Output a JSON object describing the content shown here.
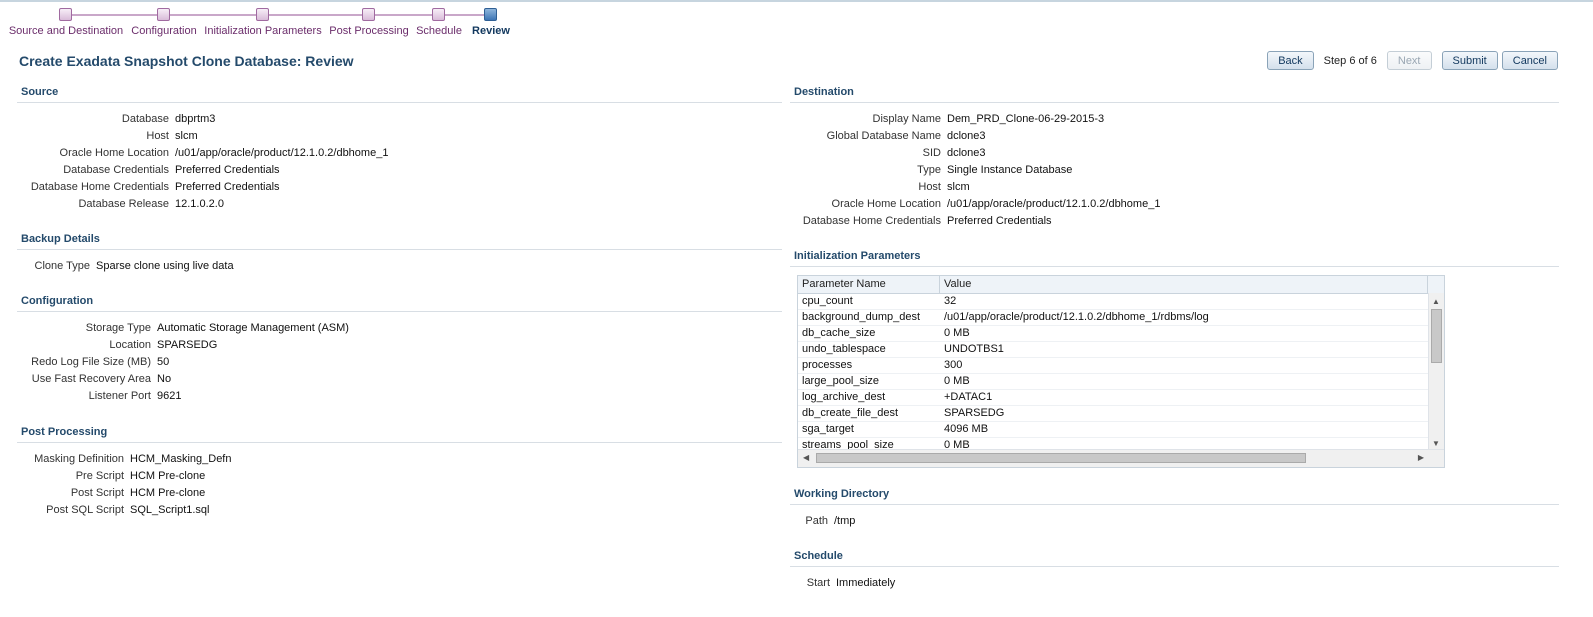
{
  "train": {
    "steps": [
      {
        "label": "Source and Destination"
      },
      {
        "label": "Configuration"
      },
      {
        "label": "Initialization Parameters"
      },
      {
        "label": "Post Processing"
      },
      {
        "label": "Schedule"
      },
      {
        "label": "Review"
      }
    ],
    "current_index": 5
  },
  "page": {
    "title": "Create Exadata Snapshot Clone Database: Review"
  },
  "actions": {
    "back": "Back",
    "step": "Step 6 of 6",
    "next": "Next",
    "submit": "Submit",
    "cancel": "Cancel"
  },
  "source": {
    "heading": "Source",
    "fields": [
      {
        "label": "Database",
        "value": "dbprtm3"
      },
      {
        "label": "Host",
        "value": "slcm"
      },
      {
        "label": "Oracle Home Location",
        "value": "/u01/app/oracle/product/12.1.0.2/dbhome_1"
      },
      {
        "label": "Database Credentials",
        "value": "Preferred Credentials"
      },
      {
        "label": "Database Home Credentials",
        "value": "Preferred Credentials"
      },
      {
        "label": "Database Release",
        "value": "12.1.0.2.0"
      }
    ]
  },
  "backup": {
    "heading": "Backup Details",
    "fields": [
      {
        "label": "Clone Type",
        "value": "Sparse clone using live data"
      }
    ]
  },
  "configuration": {
    "heading": "Configuration",
    "fields": [
      {
        "label": "Storage Type",
        "value": "Automatic Storage Management (ASM)"
      },
      {
        "label": "Location",
        "value": "SPARSEDG"
      },
      {
        "label": "Redo Log File Size (MB)",
        "value": "50"
      },
      {
        "label": "Use Fast Recovery Area",
        "value": "No"
      },
      {
        "label": "Listener Port",
        "value": "9621"
      }
    ]
  },
  "post_processing": {
    "heading": "Post Processing",
    "fields": [
      {
        "label": "Masking Definition",
        "value": "HCM_Masking_Defn"
      },
      {
        "label": "Pre Script",
        "value": "HCM Pre-clone"
      },
      {
        "label": "Post Script",
        "value": "HCM Pre-clone"
      },
      {
        "label": "Post SQL Script",
        "value": "SQL_Script1.sql"
      }
    ]
  },
  "destination": {
    "heading": "Destination",
    "fields": [
      {
        "label": "Display Name",
        "value": "Dem_PRD_Clone-06-29-2015-3"
      },
      {
        "label": "Global Database Name",
        "value": "dclone3"
      },
      {
        "label": "SID",
        "value": "dclone3"
      },
      {
        "label": "Type",
        "value": "Single Instance Database"
      },
      {
        "label": "Host",
        "value": "slcm"
      },
      {
        "label": "Oracle Home Location",
        "value": "/u01/app/oracle/product/12.1.0.2/dbhome_1"
      },
      {
        "label": "Database Home Credentials",
        "value": "Preferred Credentials"
      }
    ]
  },
  "init_params": {
    "heading": "Initialization Parameters",
    "columns": [
      "Parameter Name",
      "Value"
    ],
    "rows": [
      [
        "cpu_count",
        "32"
      ],
      [
        "background_dump_dest",
        "/u01/app/oracle/product/12.1.0.2/dbhome_1/rdbms/log"
      ],
      [
        "db_cache_size",
        "0 MB"
      ],
      [
        "undo_tablespace",
        "UNDOTBS1"
      ],
      [
        "processes",
        "300"
      ],
      [
        "large_pool_size",
        "0 MB"
      ],
      [
        "log_archive_dest",
        "+DATAC1"
      ],
      [
        "db_create_file_dest",
        "SPARSEDG"
      ],
      [
        "sga_target",
        "4096 MB"
      ],
      [
        "streams_pool_size",
        "0 MB"
      ]
    ]
  },
  "working_dir": {
    "heading": "Working Directory",
    "fields": [
      {
        "label": "Path",
        "value": "/tmp"
      }
    ]
  },
  "schedule": {
    "heading": "Schedule",
    "fields": [
      {
        "label": "Start",
        "value": "Immediately"
      }
    ]
  }
}
